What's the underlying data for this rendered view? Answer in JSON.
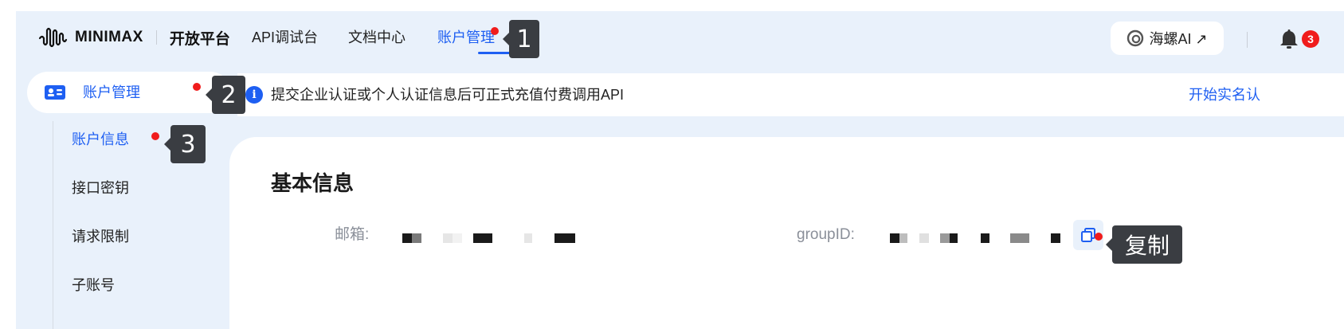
{
  "topbar": {
    "logo_text": "MINIMAX",
    "platform": "开放平台",
    "nav": [
      "API调试台",
      "文档中心",
      "账户管理"
    ],
    "active_nav": "账户管理",
    "hailuo_label": "海螺AI ↗",
    "notification_count": "3"
  },
  "sidebar": {
    "group_label": "账户管理",
    "items": [
      "账户信息",
      "接口密钥",
      "请求限制",
      "子账号"
    ],
    "active_item": "账户信息"
  },
  "notice": {
    "icon_glyph": "i",
    "text": "提交企业认证或个人认证信息后可正式充值付费调用API",
    "link": "开始实名认"
  },
  "card": {
    "title": "基本信息",
    "email_label": "邮箱:",
    "group_label": "groupID:"
  },
  "callouts": [
    "1",
    "2",
    "3",
    "复制"
  ],
  "colors": {
    "accent": "#1e5ff2",
    "background": "#e9f1fb",
    "badge": "#f01c1c",
    "callout": "#3a3d42"
  }
}
